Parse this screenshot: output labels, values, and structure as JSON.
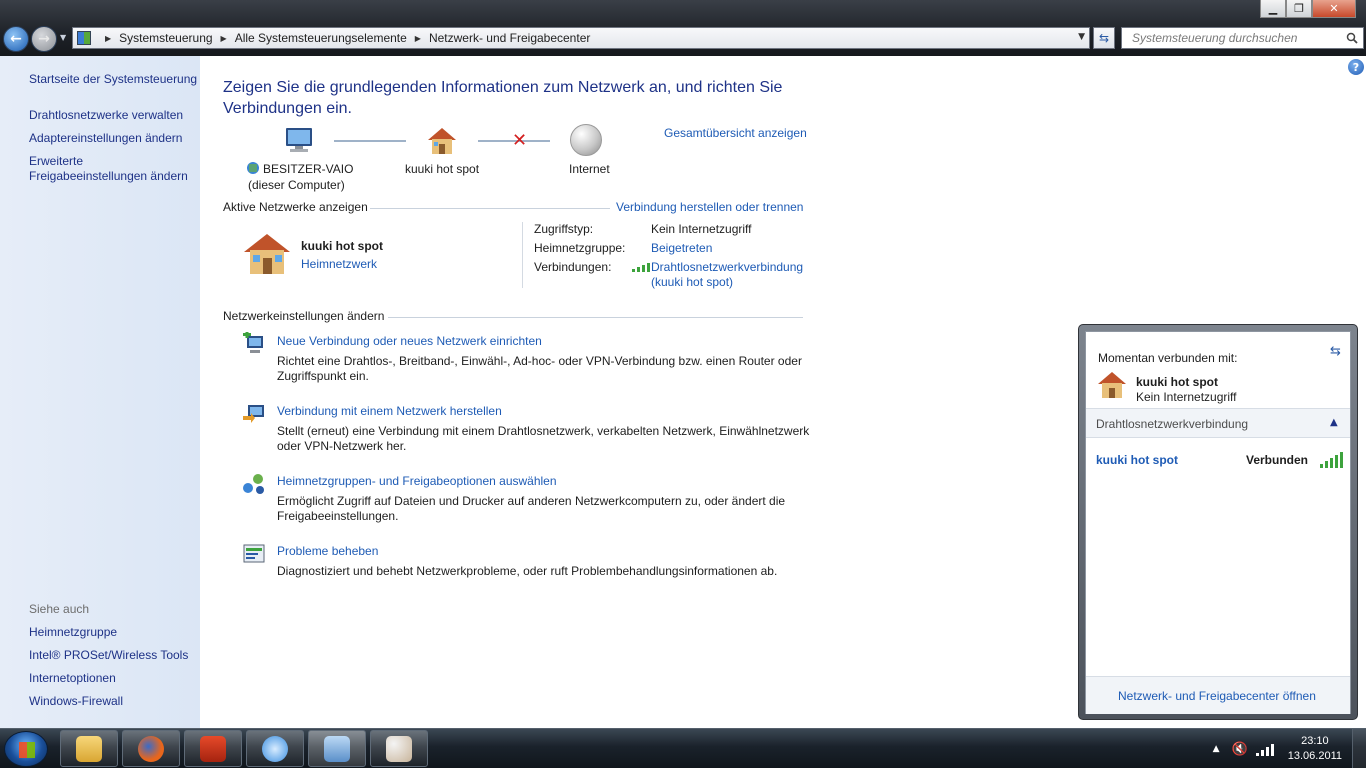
{
  "window": {
    "minimize": "▁",
    "maximize": "❐",
    "close": "✕"
  },
  "address": {
    "crumbs": [
      "Systemsteuerung",
      "Alle Systemsteuerungselemente",
      "Netzwerk- und Freigabecenter"
    ],
    "search_placeholder": "Systemsteuerung durchsuchen"
  },
  "sidebar": {
    "links": [
      "Startseite der Systemsteuerung",
      "Drahtlosnetzwerke verwalten",
      "Adaptereinstellungen ändern",
      "Erweiterte\nFreigabeeinstellungen ändern"
    ],
    "see_also_heading": "Siehe auch",
    "see_also": [
      "Heimnetzgruppe",
      "Intel® PROSet/Wireless Tools",
      "Internetoptionen",
      "Windows-Firewall"
    ]
  },
  "main": {
    "heading": "Zeigen Sie die grundlegenden Informationen zum Netzwerk an, und richten Sie Verbindungen ein.",
    "overview_link": "Gesamtübersicht anzeigen",
    "map": {
      "computer_name": "BESITZER-VAIO",
      "computer_sub": "(dieser Computer)",
      "network": "kuuki hot spot",
      "internet": "Internet"
    },
    "active": {
      "heading": "Aktive Netzwerke anzeigen",
      "connect_link": "Verbindung herstellen oder trennen",
      "network_name": "kuuki hot spot",
      "network_type": "Heimnetzwerk",
      "access_label": "Zugriffstyp:",
      "access_value": "Kein Internetzugriff",
      "homegroup_label": "Heimnetzgruppe:",
      "homegroup_value": "Beigetreten",
      "connections_label": "Verbindungen:",
      "connections_value1": "Drahtlosnetzwerkverbindung",
      "connections_value2": "(kuuki hot spot)"
    },
    "change": {
      "heading": "Netzwerkeinstellungen ändern",
      "items": [
        {
          "title": "Neue Verbindung oder neues Netzwerk einrichten",
          "desc1": "Richtet eine Drahtlos-, Breitband-, Einwähl-, Ad-hoc- oder VPN-Verbindung bzw. einen Router oder",
          "desc2": "Zugriffspunkt ein."
        },
        {
          "title": "Verbindung mit einem Netzwerk herstellen",
          "desc1": "Stellt (erneut) eine Verbindung mit einem Drahtlosnetzwerk, verkabelten Netzwerk, Einwählnetzwerk",
          "desc2": "oder VPN-Netzwerk her."
        },
        {
          "title": "Heimnetzgruppen- und Freigabeoptionen auswählen",
          "desc1": "Ermöglicht Zugriff auf Dateien und Drucker auf anderen Netzwerkcomputern zu, oder ändert die",
          "desc2": "Freigabeeinstellungen."
        },
        {
          "title": "Probleme beheben",
          "desc1": "Diagnostiziert und behebt Netzwerkprobleme, oder ruft Problembehandlungsinformationen ab.",
          "desc2": ""
        }
      ]
    }
  },
  "flyout": {
    "connected_to": "Momentan verbunden mit:",
    "network": "kuuki hot spot",
    "network_status": "Kein Internetzugriff",
    "section": "Drahtlosnetzwerkverbindung",
    "wifi_name": "kuuki hot spot",
    "wifi_state": "Verbunden",
    "footer_link": "Netzwerk- und Freigabecenter öffnen"
  },
  "taskbar": {
    "apps": [
      "explorer",
      "firefox",
      "filezilla",
      "itunes",
      "control-panel",
      "paint"
    ],
    "time": "23:10",
    "date": "13.06.2011"
  },
  "colors": {
    "link": "#1e5bb5",
    "heading": "#1e3287",
    "sidebar_bg": "#dbe6f5",
    "error_x": "#d31f1f",
    "signal": "#3da33d"
  }
}
